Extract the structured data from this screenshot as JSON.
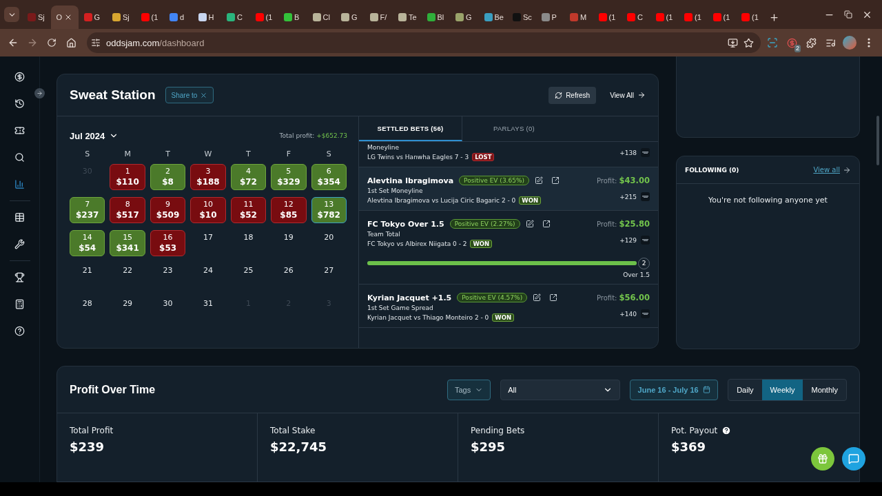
{
  "browser": {
    "tabs": [
      {
        "label": "Sj",
        "selected": false,
        "color": "#7a1a1a"
      },
      {
        "label": "O",
        "selected": true
      },
      {
        "label": "G",
        "selected": false,
        "color": "#d42020"
      },
      {
        "label": "Sj",
        "selected": false,
        "color": "#d8a630"
      },
      {
        "label": "(1",
        "selected": false,
        "color": "#ff0000"
      },
      {
        "label": "d",
        "selected": false,
        "color": "#4285f4"
      },
      {
        "label": "H",
        "selected": false,
        "color": "#c9d6f0"
      },
      {
        "label": "C",
        "selected": false,
        "color": "#2ab57d"
      },
      {
        "label": "(1",
        "selected": false,
        "color": "#ff0000"
      },
      {
        "label": "B",
        "selected": false,
        "color": "#33c23a"
      },
      {
        "label": "Cl",
        "selected": false,
        "color": "#b9b49a"
      },
      {
        "label": "G",
        "selected": false,
        "color": "#b9b49a"
      },
      {
        "label": "F/",
        "selected": false,
        "color": "#b9b49a"
      },
      {
        "label": "Te",
        "selected": false,
        "color": "#b9b49a"
      },
      {
        "label": "Bl",
        "selected": false,
        "color": "#2fae3a"
      },
      {
        "label": "G",
        "selected": false,
        "color": "#9aa36a"
      },
      {
        "label": "Be",
        "selected": false,
        "color": "#3a9ec0"
      },
      {
        "label": "Sc",
        "selected": false,
        "color": "#111111"
      },
      {
        "label": "P",
        "selected": false,
        "color": "#8a8a8a"
      },
      {
        "label": "M",
        "selected": false,
        "color": "#c0392b"
      },
      {
        "label": "(1",
        "selected": false,
        "color": "#ff0000"
      },
      {
        "label": "C",
        "selected": false,
        "color": "#ff0000"
      },
      {
        "label": "(1",
        "selected": false,
        "color": "#ff0000"
      },
      {
        "label": "(1",
        "selected": false,
        "color": "#ff0000"
      },
      {
        "label": "(1",
        "selected": false,
        "color": "#ff0000"
      },
      {
        "label": "(1",
        "selected": false,
        "color": "#ff0000"
      }
    ],
    "url_host": "oddsjam.com",
    "url_path": "/dashboard",
    "extension_badge": "2"
  },
  "sidebar": {
    "items": [
      {
        "selected": false
      },
      {
        "selected": false
      },
      {
        "selected": false
      },
      {
        "selected": false
      },
      {
        "selected": true
      },
      {
        "selected": false
      },
      {
        "selected": false
      },
      {
        "selected": false
      },
      {
        "selected": false
      },
      {
        "selected": false
      }
    ]
  },
  "sweat_station": {
    "title": "Sweat Station",
    "share": "Share to",
    "refresh": "Refresh",
    "view_all": "View All",
    "calendar": {
      "month": "Jul 2024",
      "total_label": "Total profit:",
      "total_value": "+$652.73",
      "weekdays": [
        "S",
        "M",
        "T",
        "W",
        "T",
        "F",
        "S"
      ],
      "days": [
        {
          "day": "30",
          "kind": "outside",
          "selected": false
        },
        {
          "day": "1",
          "amount": "$110",
          "kind": "loss",
          "selected": false
        },
        {
          "day": "2",
          "amount": "$8",
          "kind": "win",
          "selected": false
        },
        {
          "day": "3",
          "amount": "$188",
          "kind": "loss",
          "selected": false
        },
        {
          "day": "4",
          "amount": "$72",
          "kind": "win",
          "selected": false
        },
        {
          "day": "5",
          "amount": "$329",
          "kind": "win",
          "selected": false
        },
        {
          "day": "6",
          "amount": "$354",
          "kind": "win",
          "selected": false
        },
        {
          "day": "7",
          "amount": "$237",
          "kind": "win",
          "selected": false
        },
        {
          "day": "8",
          "amount": "$517",
          "kind": "loss",
          "selected": false
        },
        {
          "day": "9",
          "amount": "$509",
          "kind": "loss",
          "selected": false
        },
        {
          "day": "10",
          "amount": "$10",
          "kind": "loss",
          "selected": false
        },
        {
          "day": "11",
          "amount": "$52",
          "kind": "loss",
          "selected": false
        },
        {
          "day": "12",
          "amount": "$85",
          "kind": "loss",
          "selected": false
        },
        {
          "day": "13",
          "amount": "$782",
          "kind": "win",
          "selected": true
        },
        {
          "day": "14",
          "amount": "$54",
          "kind": "win",
          "selected": false
        },
        {
          "day": "15",
          "amount": "$341",
          "kind": "win",
          "selected": false
        },
        {
          "day": "16",
          "amount": "$53",
          "kind": "loss",
          "selected": false
        },
        {
          "day": "17",
          "kind": "empty",
          "selected": false
        },
        {
          "day": "18",
          "kind": "empty",
          "selected": false
        },
        {
          "day": "19",
          "kind": "empty",
          "selected": false
        },
        {
          "day": "20",
          "kind": "empty",
          "selected": false
        },
        {
          "day": "21",
          "kind": "empty",
          "selected": false
        },
        {
          "day": "22",
          "kind": "empty",
          "selected": false
        },
        {
          "day": "23",
          "kind": "empty",
          "selected": false
        },
        {
          "day": "24",
          "kind": "empty",
          "selected": false
        },
        {
          "day": "25",
          "kind": "empty",
          "selected": false
        },
        {
          "day": "26",
          "kind": "empty",
          "selected": false
        },
        {
          "day": "27",
          "kind": "empty",
          "selected": false
        },
        {
          "day": "28",
          "kind": "empty",
          "selected": false
        },
        {
          "day": "29",
          "kind": "empty",
          "selected": false
        },
        {
          "day": "30",
          "kind": "empty",
          "selected": false
        },
        {
          "day": "31",
          "kind": "empty",
          "selected": false
        },
        {
          "day": "1",
          "kind": "outside",
          "selected": false
        },
        {
          "day": "2",
          "kind": "outside",
          "selected": false
        },
        {
          "day": "3",
          "kind": "outside",
          "selected": false
        }
      ]
    },
    "tabs": [
      {
        "label": "SETTLED BETS (56)",
        "selected": true
      },
      {
        "label": "PARLAYS (0)",
        "selected": false
      }
    ],
    "bets": [
      {
        "market": "Moneyline",
        "matchup": "LG Twins vs Hanwha Eagles 7 - 3",
        "result": "LOST",
        "odds": "+138",
        "hovered": false
      },
      {
        "title": "Alevtina Ibragimova",
        "ev": "Positive EV (3.65%)",
        "market": "1st Set Moneyline",
        "matchup": "Alevtina Ibragimova vs Lucija Ciric Bagaric 2 - 0",
        "result": "WON",
        "profit_label": "Profit:",
        "profit": "$43.00",
        "odds": "+215",
        "hovered": true
      },
      {
        "title": "FC Tokyo Over 1.5",
        "ev": "Positive EV (2.27%)",
        "market": "Team Total",
        "matchup": "FC Tokyo vs Albirex Niigata 0 - 2",
        "result": "WON",
        "profit_label": "Profit:",
        "profit": "$25.80",
        "odds": "+129",
        "hovered": false,
        "progress": {
          "level": 1,
          "marker": "2",
          "line": "Over 1.5"
        }
      },
      {
        "title": "Kyrian Jacquet +1.5",
        "ev": "Positive EV (4.57%)",
        "market": "1st Set Game Spread",
        "matchup": "Kyrian Jacquet vs Thiago Monteiro 2 - 0",
        "result": "WON",
        "profit_label": "Profit:",
        "profit": "$56.00",
        "odds": "+140",
        "hovered": false
      }
    ]
  },
  "following": {
    "title": "FOLLOWING (0)",
    "view_all": "View all",
    "empty": "You're not following anyone yet"
  },
  "profit": {
    "title": "Profit Over Time",
    "tags": "Tags",
    "filter": "All",
    "date_range": "June 16 - July 16",
    "periods": [
      {
        "label": "Daily",
        "selected": false
      },
      {
        "label": "Weekly",
        "selected": true
      },
      {
        "label": "Monthly",
        "selected": false
      }
    ],
    "stats": [
      {
        "label": "Total Profit",
        "value": "$239"
      },
      {
        "label": "Total Stake",
        "value": "$22,745"
      },
      {
        "label": "Pending Bets",
        "value": "$295"
      },
      {
        "label": "Pot. Payout",
        "value": "$369",
        "help": true
      }
    ]
  }
}
